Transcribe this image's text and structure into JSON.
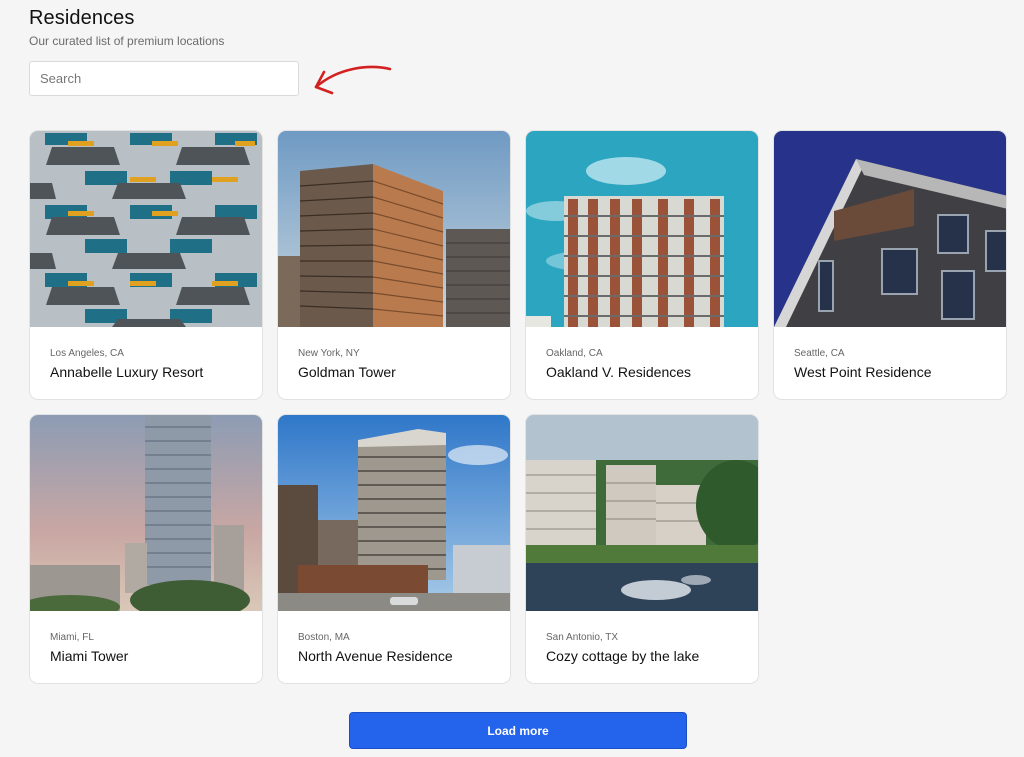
{
  "header": {
    "title": "Residences",
    "subtitle": "Our curated list of premium locations"
  },
  "search": {
    "placeholder": "Search",
    "value": ""
  },
  "annotation": {
    "icon": "red-arrow-icon",
    "color": "#d32020"
  },
  "listings": [
    {
      "location": "Los Angeles, CA",
      "title": "Annabelle Luxury Resort",
      "image": "building-facade-balconies"
    },
    {
      "location": "New York, NY",
      "title": "Goldman Tower",
      "image": "brick-towers"
    },
    {
      "location": "Oakland, CA",
      "title": "Oakland V. Residences",
      "image": "building-teal-sky"
    },
    {
      "location": "Seattle, CA",
      "title": "West Point Residence",
      "image": "modern-corner-building"
    },
    {
      "location": "Miami, FL",
      "title": "Miami Tower",
      "image": "glass-skyscraper"
    },
    {
      "location": "Boston, MA",
      "title": "North Avenue Residence",
      "image": "concrete-highrise"
    },
    {
      "location": "San Antonio, TX",
      "title": "Cozy cottage by the lake",
      "image": "lakeside-buildings"
    }
  ],
  "footer": {
    "load_more_label": "Load more"
  },
  "colors": {
    "accent": "#2463eb",
    "background": "#f5f5f5"
  }
}
